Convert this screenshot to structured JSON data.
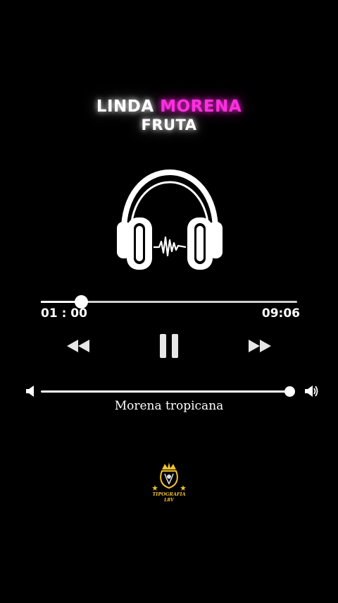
{
  "header": {
    "title_part1": "LINDA",
    "title_accent": "MORENA",
    "title_line2": "FRUTA",
    "accent_color": "#ff2fe0"
  },
  "artwork": {
    "icon": "headphones-icon"
  },
  "player": {
    "current_time": "01 : 00",
    "total_time": "09:06",
    "progress_fraction": 0.16,
    "volume_fraction": 0.99,
    "controls": {
      "rewind_icon": "rewind-icon",
      "pause_icon": "pause-icon",
      "forward_icon": "fast-forward-icon"
    },
    "volume_low_icon": "volume-low-icon",
    "volume_high_icon": "volume-high-icon"
  },
  "song": {
    "title": "Morena tropicana"
  },
  "branding": {
    "logo_text_line1": "TIPOGRAFIA",
    "logo_text_line2": "LRV",
    "logo_color": "#f2c230"
  }
}
